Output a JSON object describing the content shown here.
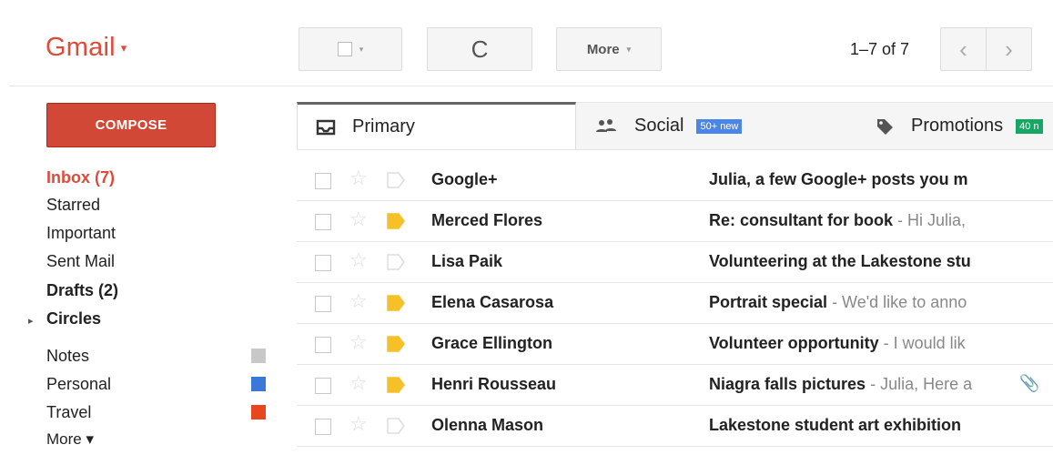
{
  "header": {
    "app_title": "Gmail",
    "app_caret": "▾",
    "more_label": "More",
    "more_caret": "▾",
    "select_caret": "▾",
    "refresh_glyph": "C",
    "pager_text": "1–7 of 7",
    "prev_glyph": "‹",
    "next_glyph": "›",
    "icons": {
      "refresh": "refresh-icon",
      "prev": "chevron-left-icon",
      "next": "chevron-right-icon"
    }
  },
  "sidebar": {
    "compose_label": "COMPOSE",
    "items": [
      {
        "label": "Inbox (7)",
        "state": "active"
      },
      {
        "label": "Starred"
      },
      {
        "label": "Important"
      },
      {
        "label": "Sent Mail"
      },
      {
        "label": "Drafts (2)",
        "state": "bold"
      },
      {
        "label": "Circles",
        "state": "bold",
        "expander": "▸"
      }
    ],
    "labels": [
      {
        "label": "Notes",
        "color": "#c8c8c8"
      },
      {
        "label": "Personal",
        "color": "#3c78d8"
      },
      {
        "label": "Travel",
        "color": "#e8461f"
      }
    ],
    "more_label": "More ▾"
  },
  "tabs": [
    {
      "label": "Primary",
      "icon": "inbox-icon",
      "selected": true
    },
    {
      "label": "Social",
      "icon": "people-icon",
      "badge": "50+ new",
      "badge_color": "#4a86e8"
    },
    {
      "label": "Promotions",
      "icon": "tag-icon",
      "badge": "40 n",
      "badge_color": "#16a765"
    }
  ],
  "emails": [
    {
      "sender": "Google+",
      "subject": "Julia, a few Google+ posts you m",
      "snippet": "",
      "important": false,
      "attachment": false
    },
    {
      "sender": "Merced Flores",
      "subject": "Re: consultant for book",
      "snippet": " - Hi Julia,",
      "important": true,
      "attachment": false
    },
    {
      "sender": "Lisa Paik",
      "subject": "Volunteering at the Lakestone stu",
      "snippet": "",
      "important": false,
      "attachment": false
    },
    {
      "sender": "Elena Casarosa",
      "subject": "Portrait special",
      "snippet": " - We'd like to anno",
      "important": true,
      "attachment": false
    },
    {
      "sender": "Grace Ellington",
      "subject": "Volunteer opportunity",
      "snippet": " - I would lik",
      "important": true,
      "attachment": false
    },
    {
      "sender": "Henri Rousseau",
      "subject": "Niagra falls pictures",
      "snippet": " - Julia, Here a",
      "important": true,
      "attachment": true
    },
    {
      "sender": "Olenna Mason",
      "subject": "Lakestone student art exhibition",
      "snippet": "",
      "important": false,
      "attachment": false
    }
  ],
  "colors": {
    "brand": "#dd4b39",
    "compose": "#d14836",
    "important_marker": "#f6c028"
  }
}
